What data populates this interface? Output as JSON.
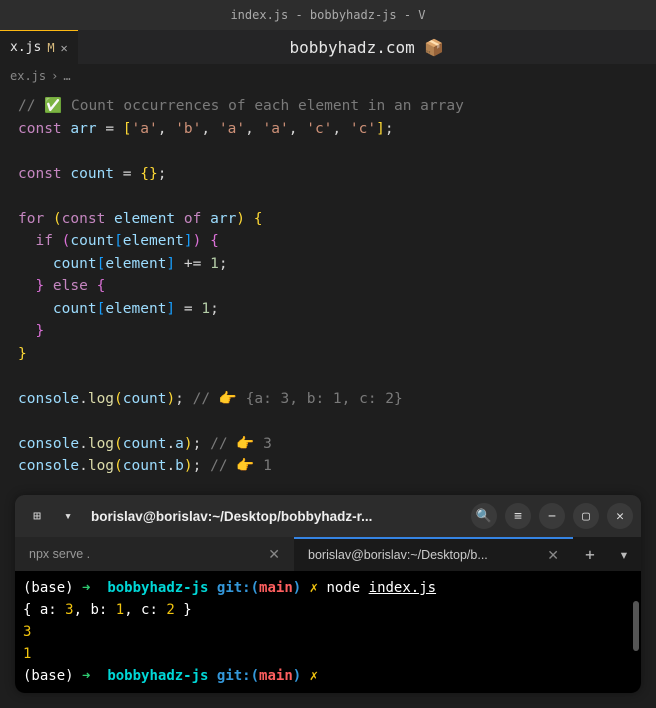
{
  "window": {
    "title": "index.js - bobbyhadz-js - V"
  },
  "tab": {
    "name": "x.js",
    "modified_marker": "M",
    "close": "✕"
  },
  "banner": {
    "text": "bobbyhadz.com 📦"
  },
  "breadcrumb": {
    "file": "ex.js",
    "sep": "›",
    "more": "…"
  },
  "code": {
    "l1_a": "// ",
    "l1_b": "✅",
    "l1_c": " Count occurrences of each element in an array",
    "l2_kw": "const",
    "l2_var": "arr",
    "l2_eq": " = ",
    "l2_lb": "[",
    "l2_s1": "'a'",
    "l2_c": ", ",
    "l2_s2": "'b'",
    "l2_s3": "'a'",
    "l2_s4": "'a'",
    "l2_s5": "'c'",
    "l2_s6": "'c'",
    "l2_rb": "]",
    "l2_sc": ";",
    "l4_kw": "const",
    "l4_var": "count",
    "l4_rest": " = ",
    "l4_lb": "{",
    "l4_rb": "}",
    "l4_sc": ";",
    "l6_for": "for",
    "l6_lp": " (",
    "l6_const": "const",
    "l6_elem": " element ",
    "l6_of": "of",
    "l6_arr": " arr",
    "l6_rp": ")",
    "l6_lb": " {",
    "l7_if": "if",
    "l7_lp": " (",
    "l7_count": "count",
    "l7_lbr": "[",
    "l7_elem": "element",
    "l7_rbr": "]",
    "l7_rp": ")",
    "l7_lb": " {",
    "l8_count": "count",
    "l8_lbr": "[",
    "l8_elem": "element",
    "l8_rbr": "]",
    "l8_op": " += ",
    "l8_num": "1",
    "l8_sc": ";",
    "l9_rb": "}",
    "l9_else": " else ",
    "l9_lb": "{",
    "l10_count": "count",
    "l10_lbr": "[",
    "l10_elem": "element",
    "l10_rbr": "]",
    "l10_op": " = ",
    "l10_num": "1",
    "l10_sc": ";",
    "l11_rb": "}",
    "l12_rb": "}",
    "l14_console": "console",
    "l14_dot": ".",
    "l14_log": "log",
    "l14_lp": "(",
    "l14_count": "count",
    "l14_rp": ")",
    "l14_sc": ";",
    "l14_cm": " // 👉 {a: 3, b: 1, c: 2}",
    "l16_console": "console",
    "l16_dot": ".",
    "l16_log": "log",
    "l16_lp": "(",
    "l16_count": "count",
    "l16_dot2": ".",
    "l16_a": "a",
    "l16_rp": ")",
    "l16_sc": ";",
    "l16_cm": " // 👉 3",
    "l17_console": "console",
    "l17_dot": ".",
    "l17_log": "log",
    "l17_lp": "(",
    "l17_count": "count",
    "l17_dot2": ".",
    "l17_b": "b",
    "l17_rp": ")",
    "l17_sc": ";",
    "l17_cm": " // 👉 1"
  },
  "terminal": {
    "titlebar": {
      "new_tab_icon": "⊞",
      "dropdown_icon": "▾",
      "title": "borislav@borislav:~/Desktop/bobbyhadz-r...",
      "search_icon": "🔍",
      "menu_icon": "≡",
      "min_icon": "−",
      "max_icon": "▢",
      "close_icon": "✕"
    },
    "tabs": {
      "tab1": "npx serve .",
      "tab2": "borislav@borislav:~/Desktop/b...",
      "close": "✕",
      "plus": "+",
      "dropdown": "▾"
    },
    "output": {
      "l1_base": "(base) ",
      "l1_arrow": "➜  ",
      "l1_dir": "bobbyhadz-js",
      "l1_git": " git:(",
      "l1_branch": "main",
      "l1_git2": ") ",
      "l1_dirty": "✗",
      "l1_cmd": " node ",
      "l1_file": "index.js",
      "l2": "{ a: ",
      "l2_3": "3",
      "l2_m": ", b: ",
      "l2_1": "1",
      "l2_m2": ", c: ",
      "l2_2": "2",
      "l2_e": " }",
      "l3": "3",
      "l4": "1",
      "l5_base": "(base) ",
      "l5_arrow": "➜  ",
      "l5_dir": "bobbyhadz-js",
      "l5_git": " git:(",
      "l5_branch": "main",
      "l5_git2": ") ",
      "l5_dirty": "✗"
    }
  }
}
